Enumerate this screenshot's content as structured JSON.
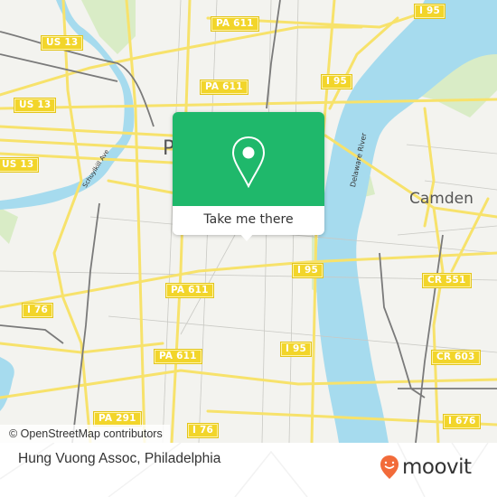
{
  "map": {
    "attribution": "© OpenStreetMap contributors",
    "city_label": "P",
    "camden_label": "Camden",
    "river_label": "Delaware River",
    "street_label": "Schuylkill Ave",
    "shields": [
      {
        "id": "us13-a",
        "text": "US 13"
      },
      {
        "id": "us13-b",
        "text": "US 13"
      },
      {
        "id": "us13-c",
        "text": "US 13"
      },
      {
        "id": "pa611-a",
        "text": "PA 611"
      },
      {
        "id": "pa611-b",
        "text": "PA 611"
      },
      {
        "id": "pa611-c",
        "text": "PA 611"
      },
      {
        "id": "pa611-d",
        "text": "PA 611"
      },
      {
        "id": "i95-a",
        "text": "I 95"
      },
      {
        "id": "i95-b",
        "text": "I 95"
      },
      {
        "id": "i95-c",
        "text": "I 95"
      },
      {
        "id": "i95-d",
        "text": "I 95"
      },
      {
        "id": "i76-a",
        "text": "I 76"
      },
      {
        "id": "i76-b",
        "text": "I 76"
      },
      {
        "id": "pa291",
        "text": "PA 291"
      },
      {
        "id": "cr551",
        "text": "CR 551"
      },
      {
        "id": "cr603",
        "text": "CR 603"
      },
      {
        "id": "i676",
        "text": "I 676"
      }
    ],
    "colors": {
      "land": "#f3f3ef",
      "water": "#a6dbee",
      "road": "#f7e26b",
      "park": "#d7ecc2",
      "rail": "#777777"
    }
  },
  "popup": {
    "button_label": "Take me there",
    "accent": "#1fb86b"
  },
  "footer": {
    "place_name": "Hung Vuong Assoc, Philadelphia",
    "brand": "moovit",
    "brand_color": "#f26b3a"
  }
}
